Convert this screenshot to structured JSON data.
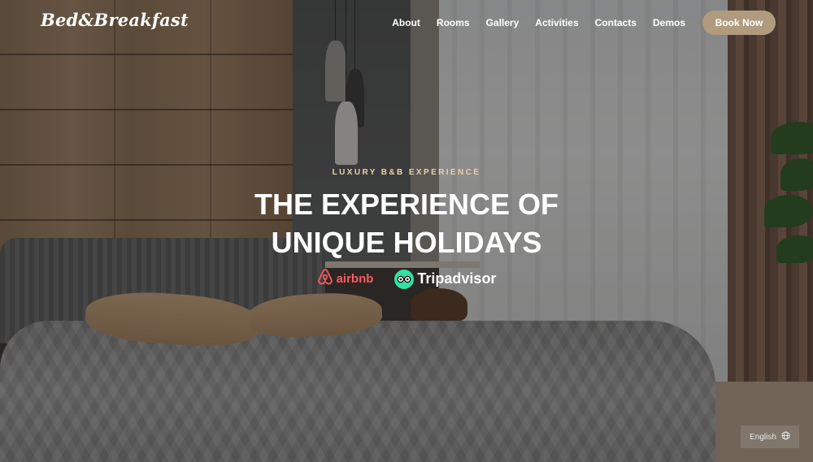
{
  "brand": {
    "logo": "Bed&Breakfast"
  },
  "nav": {
    "items": [
      {
        "label": "About"
      },
      {
        "label": "Rooms"
      },
      {
        "label": "Gallery"
      },
      {
        "label": "Activities"
      },
      {
        "label": "Contacts"
      },
      {
        "label": "Demos"
      }
    ],
    "cta": "Book Now"
  },
  "hero": {
    "eyebrow": "LUXURY B&B EXPERIENCE",
    "headline_line1": "THE EXPERIENCE OF",
    "headline_line2": "UNIQUE HOLIDAYS"
  },
  "badges": {
    "airbnb": "airbnb",
    "tripadvisor": "Tripadvisor"
  },
  "language": {
    "label": "English",
    "icon": "globe-icon"
  },
  "colors": {
    "accent": "#b09b7f",
    "eyebrow": "#e6d4a8",
    "airbnb": "#ff5a5f",
    "tripadvisor": "#34e0a1"
  }
}
